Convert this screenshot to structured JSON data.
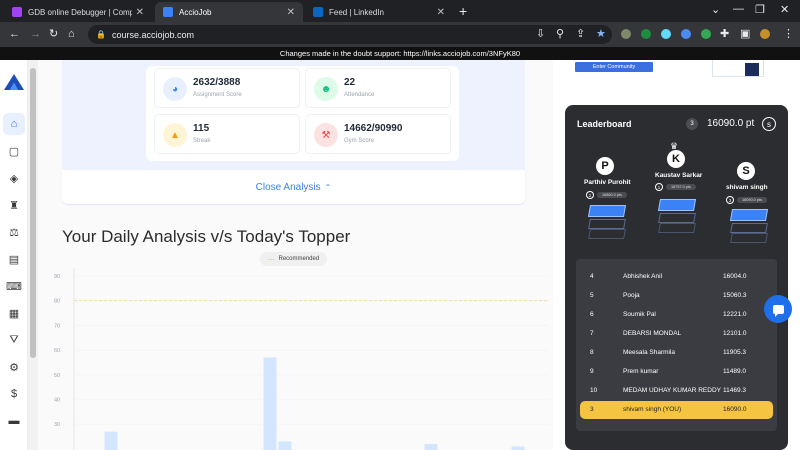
{
  "browser": {
    "tabs": [
      {
        "title": "GDB online Debugger | Compiler",
        "favicon_color": "#a142f4"
      },
      {
        "title": "AccioJob",
        "favicon_color": "#3b82f6"
      },
      {
        "title": "Feed | LinkedIn",
        "favicon_color": "#0a66c2"
      }
    ],
    "new_tab": "+",
    "url": "course.acciojob.com"
  },
  "notice": "Changes made in the doubt support: https://links.acciojob.com/3NFyK80",
  "stats": [
    {
      "value": "2632/3888",
      "label": "Assignment Score",
      "icon": "pie-chart-icon",
      "color": "#3b82f6",
      "bg": "#e8f0ff"
    },
    {
      "value": "22",
      "label": "Attendance",
      "icon": "person-icon",
      "color": "#10b981",
      "bg": "#dcfce7"
    },
    {
      "value": "115",
      "label": "Streak",
      "icon": "flame-icon",
      "color": "#f59e0b",
      "bg": "#fff4d6"
    },
    {
      "value": "14662/90990",
      "label": "Gym Score",
      "icon": "dumbbell-icon",
      "color": "#ef4444",
      "bg": "#fde2e2"
    }
  ],
  "close_analysis": "Close Analysis",
  "section_title": "Your Daily Analysis v/s Today's Topper",
  "chip": {
    "dots": "....",
    "label": "Recommended"
  },
  "chart_data": {
    "type": "bar",
    "title": "",
    "xlabel": "",
    "ylabel": "",
    "ylim": [
      0,
      90
    ],
    "yticks": [
      30,
      40,
      50,
      60,
      70,
      80,
      90
    ],
    "reference_line": 80,
    "bars": [
      {
        "x": 1,
        "value": 27
      },
      {
        "x": 2,
        "value": 57
      },
      {
        "x": 3,
        "value": 23
      },
      {
        "x": 4,
        "value": 22
      },
      {
        "x": 5,
        "value": 21
      }
    ],
    "bar_color": "#d4e6ff"
  },
  "right_panel": {
    "community_button": "Enter Community",
    "leaderboard": {
      "title": "Leaderboard",
      "my_rank": "3",
      "my_points": "16090.0 pt",
      "s_button": "s",
      "podium": [
        {
          "initial": "P",
          "name": "Parthiv Purohit",
          "rank": "2",
          "points": "16860.0 pts"
        },
        {
          "initial": "K",
          "name": "Kaustav Sarkar",
          "rank": "1",
          "points": "18757.0 pts"
        },
        {
          "initial": "S",
          "name": "shivam singh",
          "rank": "3",
          "points": "16090.0 pts"
        }
      ],
      "rows": [
        {
          "rank": "4",
          "name": "Abhishek Anil",
          "score": "16004.0"
        },
        {
          "rank": "5",
          "name": "Pooja",
          "score": "15060.3"
        },
        {
          "rank": "6",
          "name": "Soumik Pal",
          "score": "12221.0"
        },
        {
          "rank": "7",
          "name": "DEBARSI MONDAL",
          "score": "12101.0"
        },
        {
          "rank": "8",
          "name": "Meesala Sharmila",
          "score": "11905.3"
        },
        {
          "rank": "9",
          "name": "Prem kumar",
          "score": "11489.0"
        },
        {
          "rank": "10",
          "name": "MEDAM UDHAY KUMAR REDDY",
          "score": "11469.3"
        }
      ],
      "you_row": {
        "rank": "3",
        "name": "shivam singh (YOU)",
        "score": "16090.0"
      }
    }
  }
}
